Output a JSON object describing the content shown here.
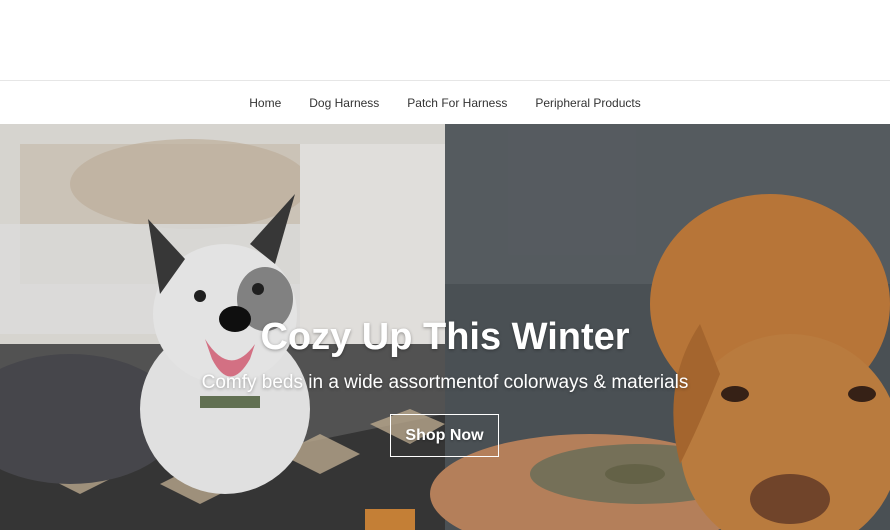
{
  "nav": {
    "items": [
      {
        "label": "Home"
      },
      {
        "label": "Dog Harness"
      },
      {
        "label": "Patch For Harness"
      },
      {
        "label": "Peripheral Products"
      }
    ]
  },
  "hero": {
    "title": "Cozy Up This Winter",
    "subtitle": "Comfy beds in a wide assortmentof colorways & materials",
    "cta_label": "Shop Now",
    "image_subject": "white-husky-dog-and-brown-dog-on-pet-beds"
  },
  "colors": {
    "nav_text": "#333333",
    "hero_text": "#ffffff",
    "divider": "#e6e6e6"
  }
}
